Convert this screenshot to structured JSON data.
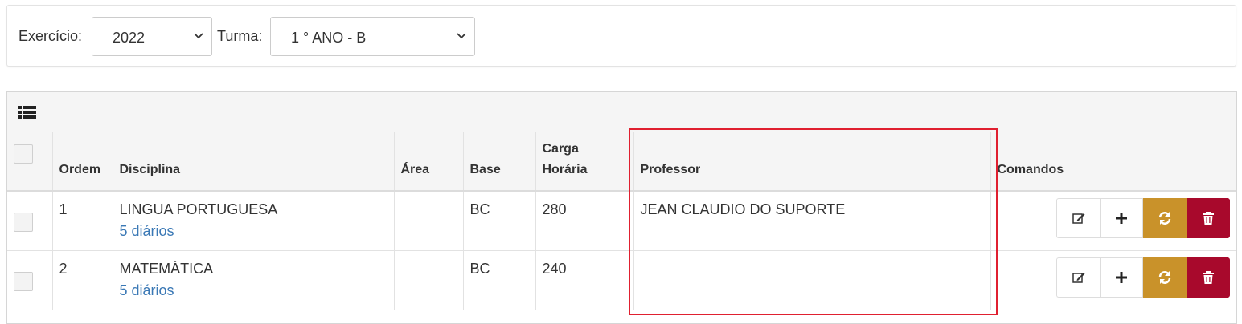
{
  "filters": {
    "exercicio_label": "Exercício:",
    "exercicio_value": "2022",
    "turma_label": "Turma:",
    "turma_value": "1 ° ANO - B"
  },
  "grid": {
    "toolbar_icon": "list-icon",
    "columns": {
      "ordem": "Ordem",
      "disciplina": "Disciplina",
      "area": "Área",
      "base": "Base",
      "carga_line1": "Carga",
      "carga_line2": "Horária",
      "professor": "Professor",
      "comandos": "Comandos"
    },
    "rows": [
      {
        "ordem": "1",
        "disciplina": "LINGUA PORTUGUESA",
        "diarios": "5 diários",
        "area": "",
        "base": "BC",
        "carga": "280",
        "professor": "JEAN CLAUDIO DO SUPORTE"
      },
      {
        "ordem": "2",
        "disciplina": "MATEMÁTICA",
        "diarios": "5 diários",
        "area": "",
        "base": "BC",
        "carga": "240",
        "professor": ""
      }
    ],
    "command_icons": [
      "edit-icon",
      "plus-icon",
      "refresh-icon",
      "trash-icon"
    ]
  },
  "colors": {
    "sync_button": "#c9922a",
    "delete_button": "#a8092c",
    "link": "#3a78b5",
    "highlight": "#e02030"
  }
}
